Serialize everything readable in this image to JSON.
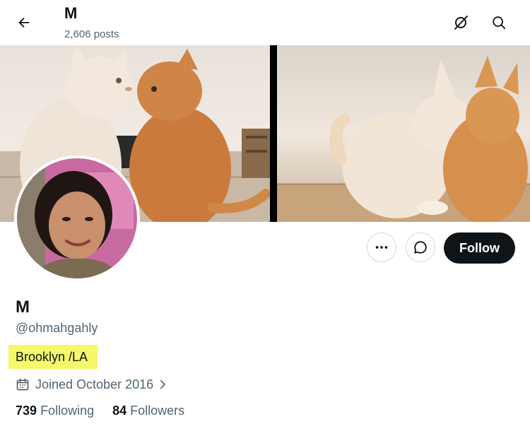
{
  "header": {
    "name": "M",
    "posts_count": "2,606 posts"
  },
  "profile": {
    "display_name": "M",
    "handle": "@ohmahgahly",
    "location": "Brooklyn /LA",
    "joined": "Joined October 2016",
    "following_count": "739",
    "following_label": "Following",
    "followers_count": "84",
    "followers_label": "Followers"
  },
  "actions": {
    "follow_label": "Follow"
  },
  "icons": {
    "back": "arrow-left-icon",
    "grok": "grok-icon",
    "search": "search-icon",
    "more": "more-icon",
    "message": "message-icon",
    "calendar": "calendar-icon",
    "chevron": "chevron-right-icon"
  },
  "colors": {
    "text_primary": "#0f1419",
    "text_secondary": "#536471",
    "follow_bg": "#0f1419",
    "highlight": "#f4f86a"
  }
}
